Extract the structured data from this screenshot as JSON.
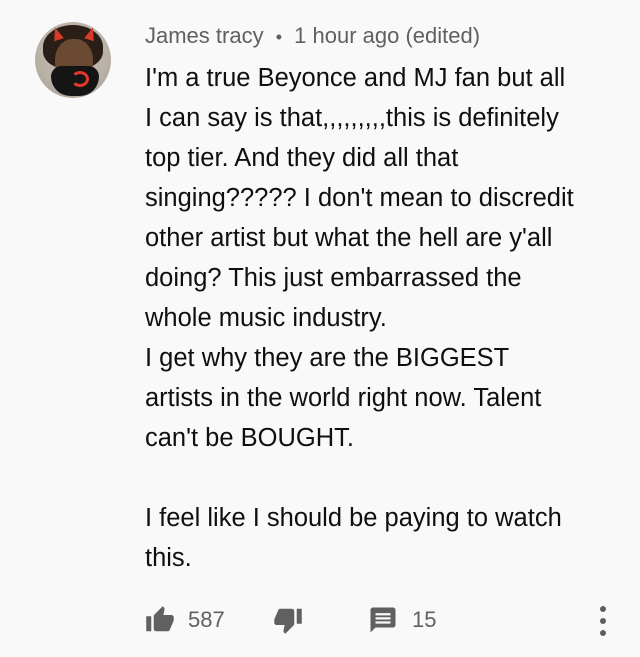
{
  "comment": {
    "author": "James tracy",
    "separator": "•",
    "timestamp": "1 hour ago (edited)",
    "lines": [
      "I'm a true Beyonce and MJ fan but all",
      "I can say is that,,,,,,,,,this is definitely",
      "top tier. And they did all that",
      "singing????? I don't mean to discredit",
      "other artist but what the hell are y'all",
      "doing? This just embarrassed the",
      "whole music industry.",
      "I get why they are the BIGGEST",
      "artists in the world right now. Talent",
      "can't be BOUGHT.",
      "",
      "I feel like I should be paying to watch",
      "this."
    ]
  },
  "actions": {
    "likes": "587",
    "replies": "15",
    "icons": [
      "thumbs-up-icon",
      "thumbs-down-icon",
      "reply-icon",
      "more-vertical-icon"
    ]
  },
  "colors": {
    "background": "#f9f9f9",
    "text": "#0f0f0f",
    "secondary": "#606060"
  }
}
